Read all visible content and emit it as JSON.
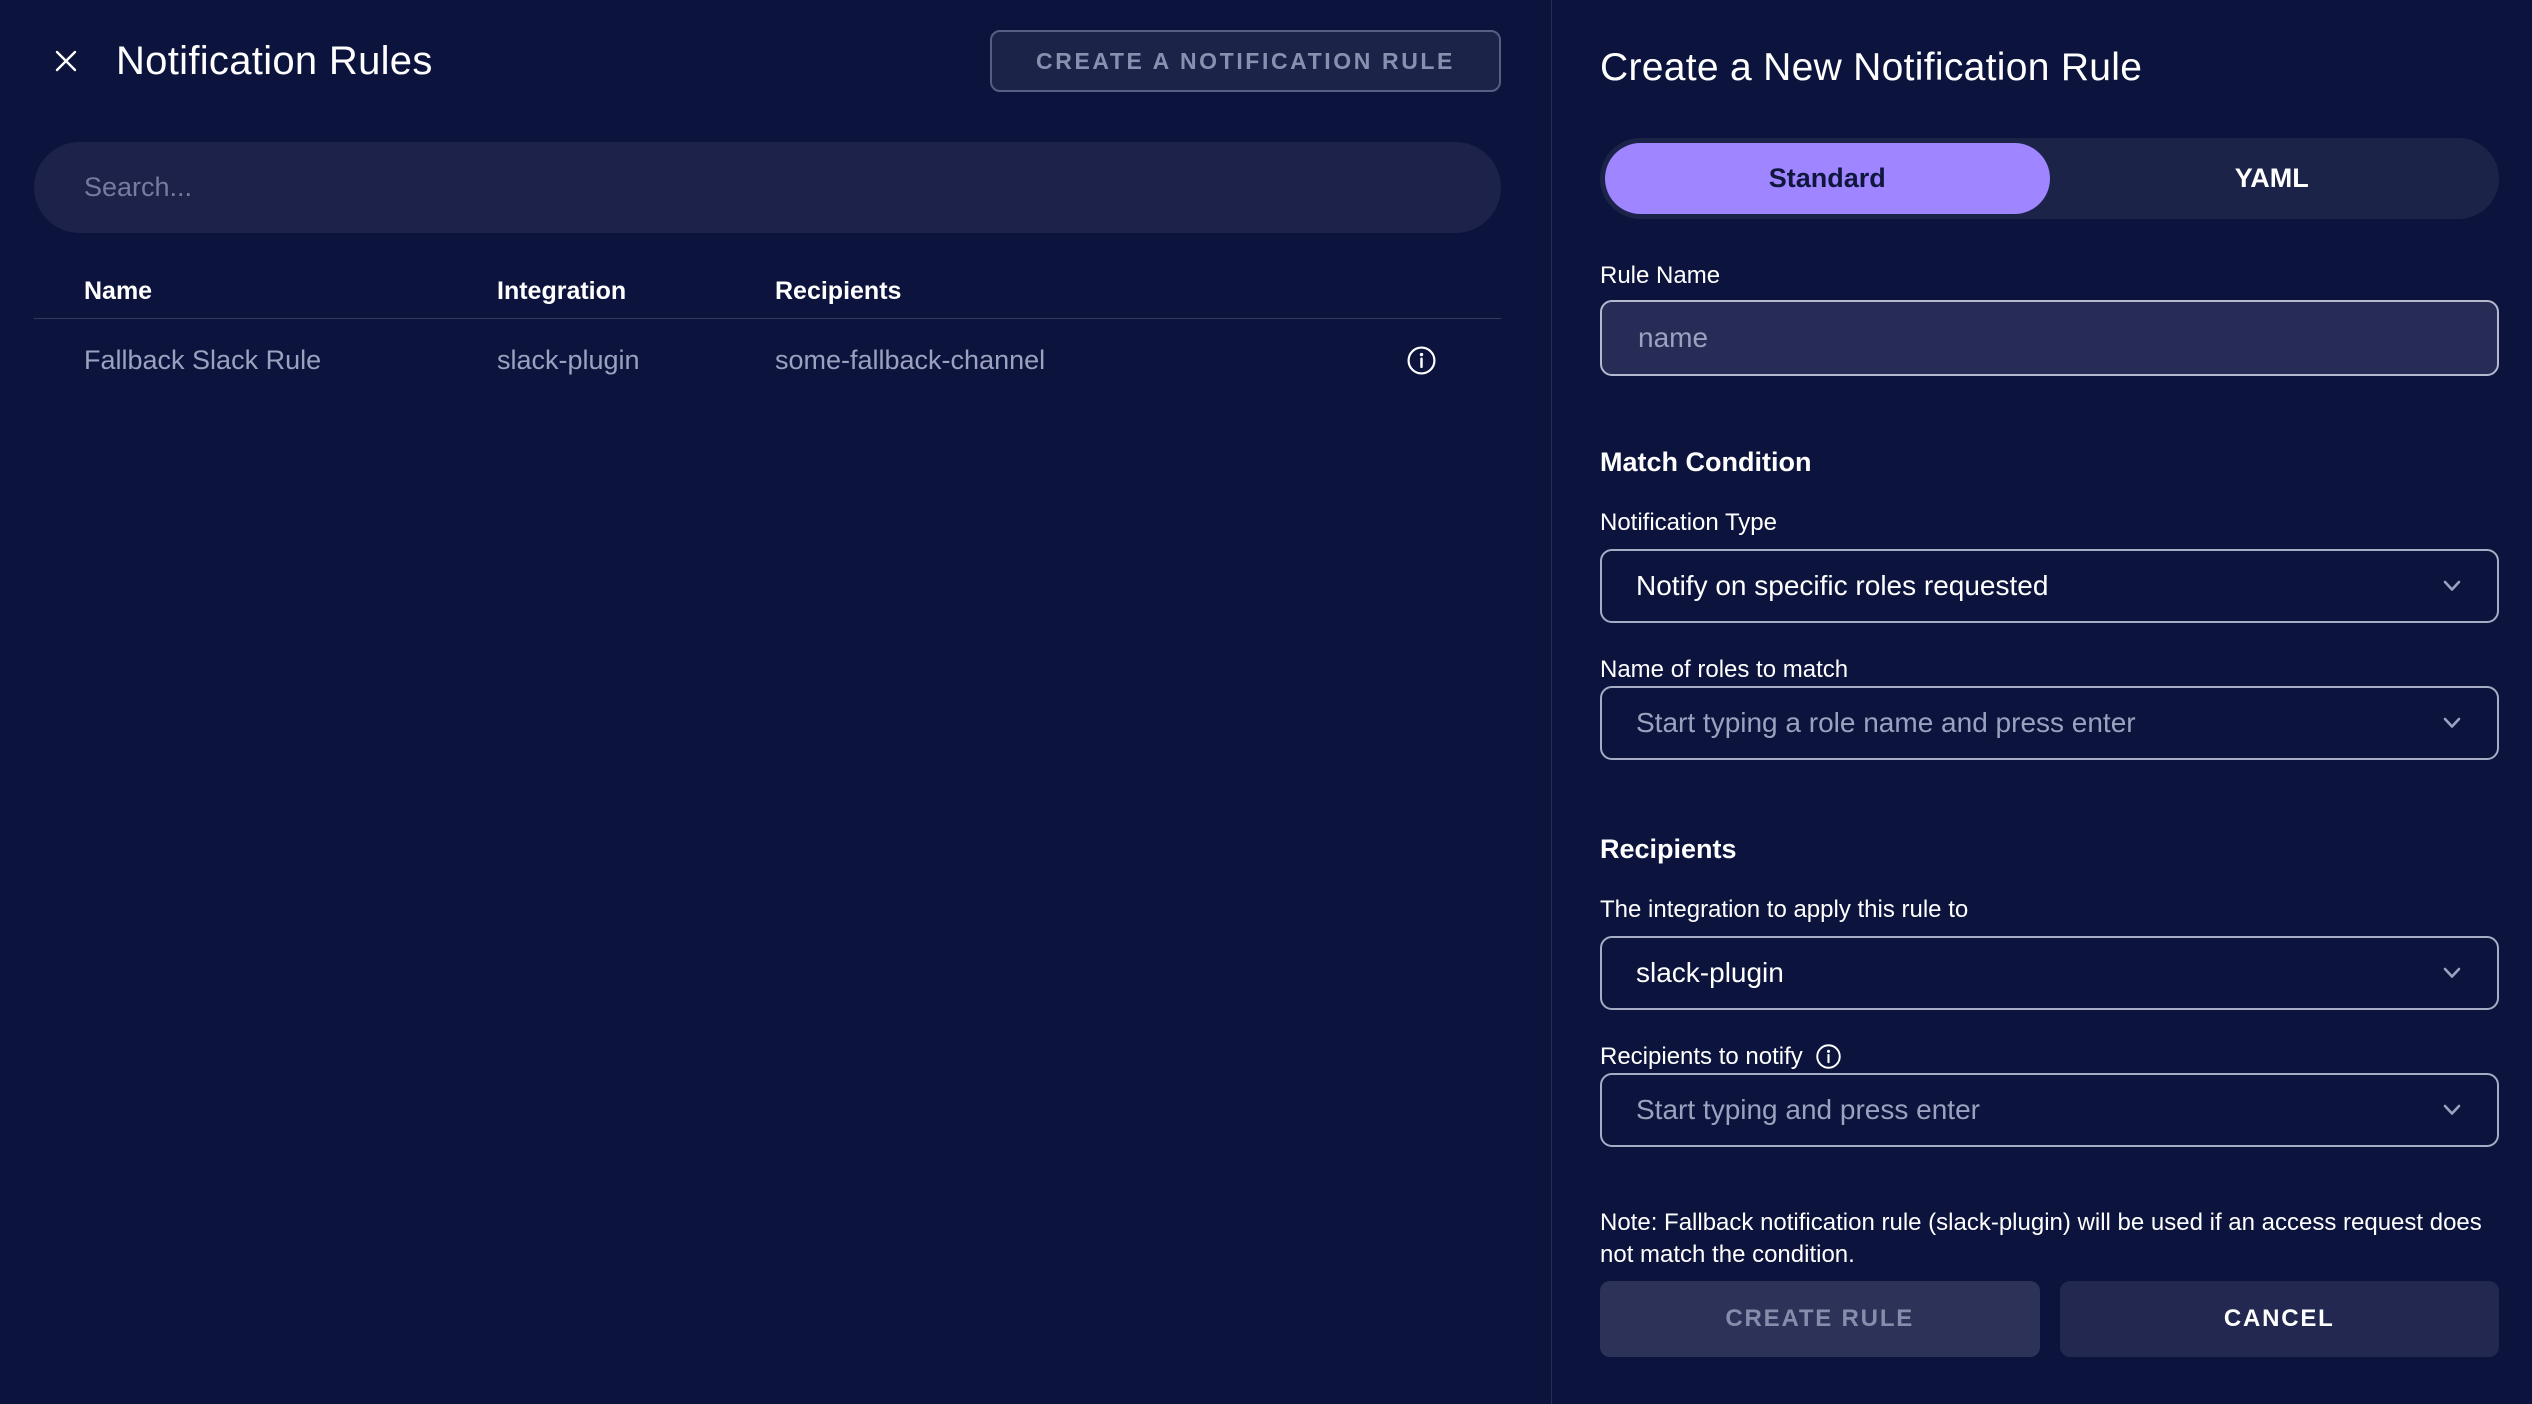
{
  "colors": {
    "background": "#0C143D",
    "accent_purple": "#9F85FF",
    "muted_text": "#9BA1BE",
    "surface": "#1C2349"
  },
  "left_panel": {
    "title": "Notification Rules",
    "create_button_label": "CREATE A NOTIFICATION RULE",
    "search_placeholder": "Search...",
    "table": {
      "columns": [
        "Name",
        "Integration",
        "Recipients"
      ],
      "rows": [
        {
          "name": "Fallback Slack Rule",
          "integration": "slack-plugin",
          "recipients": "some-fallback-channel"
        }
      ]
    }
  },
  "right_panel": {
    "title": "Create a New Notification Rule",
    "tabs": [
      {
        "label": "Standard",
        "active": true
      },
      {
        "label": "YAML",
        "active": false
      }
    ],
    "rule_name": {
      "label": "Rule Name",
      "placeholder": "name"
    },
    "match_condition": {
      "heading": "Match Condition",
      "notification_type": {
        "label": "Notification Type",
        "value": "Notify on specific roles requested"
      },
      "roles": {
        "label": "Name of roles to match",
        "placeholder": "Start typing a role name and press enter"
      }
    },
    "recipients": {
      "heading": "Recipients",
      "integration": {
        "label": "The integration to apply this rule to",
        "value": "slack-plugin"
      },
      "notify": {
        "label": "Recipients to notify",
        "placeholder": "Start typing and press enter"
      }
    },
    "note": "Note: Fallback notification rule (slack-plugin) will be used if an access request does not match the condition.",
    "buttons": {
      "create": "CREATE RULE",
      "cancel": "CANCEL"
    }
  }
}
